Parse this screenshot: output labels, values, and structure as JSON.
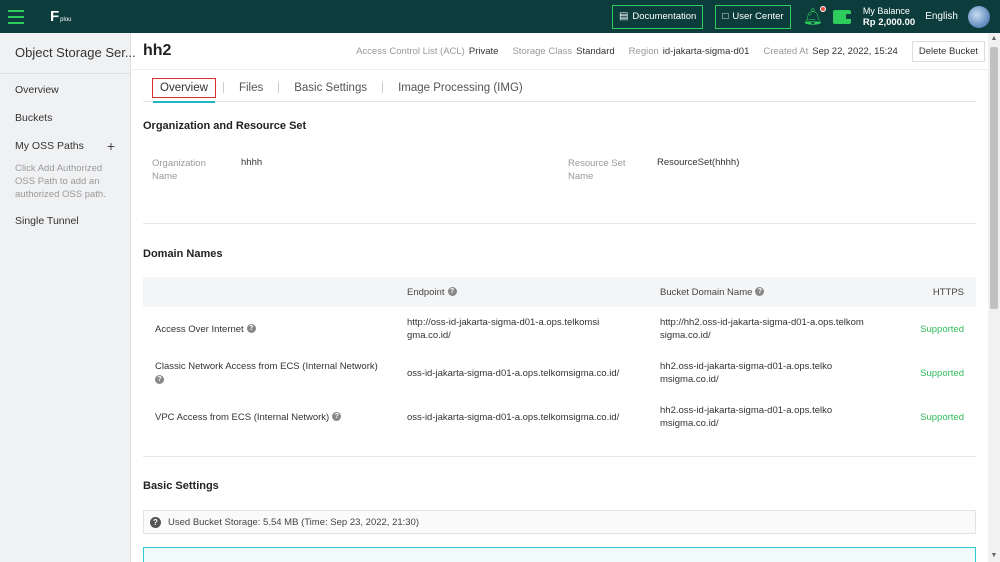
{
  "topbar": {
    "logo_text": "F",
    "logo_sub": "plou",
    "documentation_label": "Documentation",
    "user_center_label": "User Center",
    "balance_label": "My Balance",
    "balance_amount": "Rp 2,000.00",
    "language": "English"
  },
  "sidebar": {
    "title": "Object Storage Ser...",
    "overview": "Overview",
    "buckets": "Buckets",
    "my_oss_paths": "My OSS Paths",
    "oss_hint": "Click Add Authorized OSS Path to add an authorized OSS path.",
    "single_tunnel": "Single Tunnel"
  },
  "header": {
    "bucket_name": "hh2",
    "acl_label": "Access Control List (ACL)",
    "acl_value": "Private",
    "storage_class_label": "Storage Class",
    "storage_class_value": "Standard",
    "region_label": "Region",
    "region_value": "id-jakarta-sigma-d01",
    "created_label": "Created At",
    "created_value": "Sep 22, 2022, 15:24",
    "delete_label": "Delete Bucket"
  },
  "tabs": [
    "Overview",
    "Files",
    "Basic Settings",
    "Image Processing (IMG)"
  ],
  "org_section": {
    "title": "Organization and Resource Set",
    "org_label": "Organization Name",
    "org_value": "hhhh",
    "rs_label": "Resource Set Name",
    "rs_value": "ResourceSet(hhhh)"
  },
  "domain_section": {
    "title": "Domain Names",
    "headers": [
      "",
      "Endpoint",
      "Bucket Domain Name",
      "HTTPS"
    ],
    "rows": [
      {
        "name": "Access Over Internet",
        "endpoint": "http://oss-id-jakarta-sigma-d01-a.ops.telkomsigma.co.id/",
        "bucket_domain": "http://hh2.oss-id-jakarta-sigma-d01-a.ops.telkomsigma.co.id/",
        "https": "Supported"
      },
      {
        "name": "Classic Network Access from ECS (Internal Network)",
        "endpoint": "oss-id-jakarta-sigma-d01-a.ops.telkomsigma.co.id/",
        "bucket_domain": "hh2.oss-id-jakarta-sigma-d01-a.ops.telkomsigma.co.id/",
        "https": "Supported"
      },
      {
        "name": "VPC Access from ECS (Internal Network)",
        "endpoint": "oss-id-jakarta-sigma-d01-a.ops.telkomsigma.co.id/",
        "bucket_domain": "hh2.oss-id-jakarta-sigma-d01-a.ops.telkomsigma.co.id/",
        "https": "Supported"
      }
    ]
  },
  "basic_section": {
    "title": "Basic Settings",
    "used_storage": "Used Bucket Storage: 5.54 MB (Time: Sep 23, 2022, 21:30)"
  },
  "colors": {
    "topbar_bg": "#0d3c3c",
    "accent_green": "#2ecc5c",
    "tab_underline": "#1fb6c6",
    "supported": "#2ebd59",
    "highlight_box": "#d93030"
  }
}
